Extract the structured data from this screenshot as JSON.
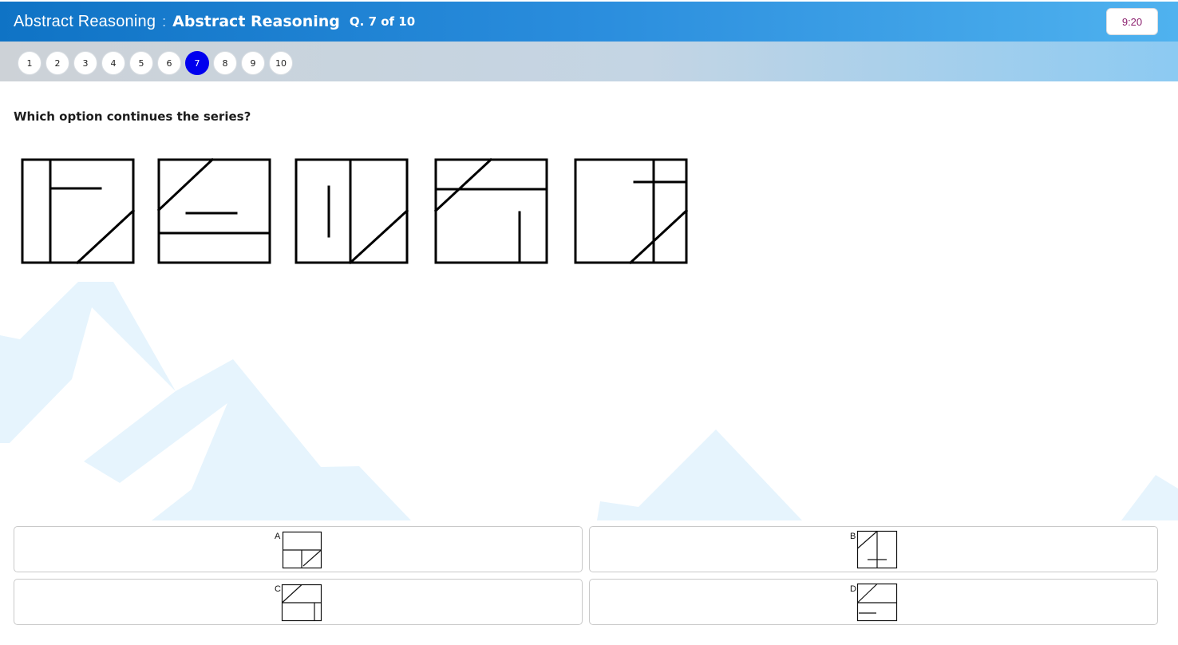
{
  "header": {
    "subject": "Abstract Reasoning",
    "separator": ":",
    "title": "Abstract Reasoning",
    "question_counter": "Q. 7 of 10",
    "timer": "9:20"
  },
  "question_nav": {
    "items": [
      "1",
      "2",
      "3",
      "4",
      "5",
      "6",
      "7",
      "8",
      "9",
      "10"
    ],
    "active": "7"
  },
  "question": {
    "text": "Which option continues the series?"
  },
  "options": {
    "a": "A",
    "b": "B",
    "c": "C",
    "d": "D"
  },
  "colors": {
    "header_start": "#0f73c5",
    "header_end": "#4fb2ef",
    "active_question": "#0000ee",
    "timer_text": "#8b1f6e",
    "mountain_bg": "#e6f4fd"
  },
  "icons": {
    "background": "mountain-silhouette"
  }
}
